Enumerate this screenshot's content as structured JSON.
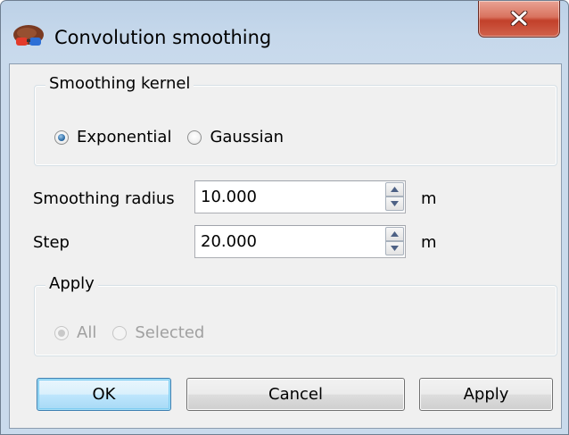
{
  "window": {
    "title": "Convolution smoothing",
    "close_symbol": "x"
  },
  "kernel_group": {
    "title": "Smoothing kernel",
    "options": [
      {
        "label": "Exponential",
        "checked": true
      },
      {
        "label": "Gaussian",
        "checked": false
      }
    ]
  },
  "fields": {
    "radius": {
      "label": "Smoothing radius",
      "value": "10.000",
      "unit": "m"
    },
    "step": {
      "label": "Step",
      "value": "20.000",
      "unit": "m"
    }
  },
  "apply_group": {
    "title": "Apply",
    "enabled": false,
    "options": [
      {
        "label": "All",
        "checked": true
      },
      {
        "label": "Selected",
        "checked": false
      }
    ]
  },
  "buttons": {
    "ok": "OK",
    "cancel": "Cancel",
    "apply": "Apply"
  },
  "icons": {
    "app": "colored-glasses-icon",
    "close": "close-icon",
    "spin_up": "arrow-up-icon",
    "spin_down": "arrow-down-icon"
  },
  "colors": {
    "default_button_border": "#3c7fb1",
    "close_button": "#c2402a",
    "radio_checked": "#2f6fa8"
  }
}
